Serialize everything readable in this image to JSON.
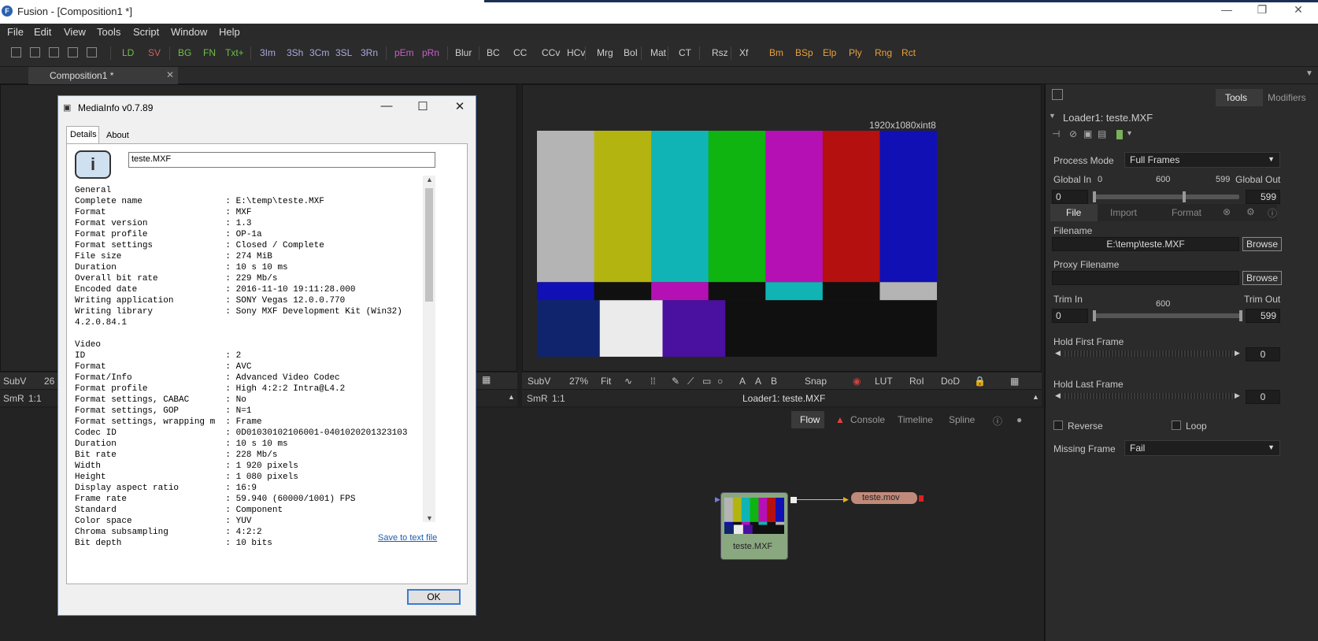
{
  "app": {
    "title": "Fusion - [Composition1 *]",
    "logo": "F"
  },
  "menu": [
    "File",
    "Edit",
    "View",
    "Tools",
    "Script",
    "Window",
    "Help"
  ],
  "toolbar": {
    "items": [
      {
        "label": "LD",
        "color": "#6fbf4a"
      },
      {
        "label": "SV",
        "color": "#d06060"
      },
      {
        "label": "BG",
        "color": "#6fbf4a"
      },
      {
        "label": "FN",
        "color": "#6fbf4a"
      },
      {
        "label": "Txt+",
        "color": "#6fbf4a"
      },
      {
        "label": "3Im",
        "color": "#a9a9e0"
      },
      {
        "label": "3Sh",
        "color": "#a9a9e0"
      },
      {
        "label": "3Cm",
        "color": "#a9a9e0"
      },
      {
        "label": "3SL",
        "color": "#a9a9e0"
      },
      {
        "label": "3Rn",
        "color": "#a9a9e0"
      },
      {
        "label": "pEm",
        "color": "#c55ec5"
      },
      {
        "label": "pRn",
        "color": "#c55ec5"
      },
      {
        "label": "Blur",
        "color": "#cfcfcf"
      },
      {
        "label": "BC",
        "color": "#cfcfcf"
      },
      {
        "label": "CC",
        "color": "#cfcfcf"
      },
      {
        "label": "CCv",
        "color": "#cfcfcf"
      },
      {
        "label": "HCv",
        "color": "#cfcfcf"
      },
      {
        "label": "Mrg",
        "color": "#cfcfcf"
      },
      {
        "label": "BoI",
        "color": "#cfcfcf"
      },
      {
        "label": "Mat",
        "color": "#cfcfcf"
      },
      {
        "label": "CT",
        "color": "#cfcfcf"
      },
      {
        "label": "Rsz",
        "color": "#cfcfcf"
      },
      {
        "label": "Xf",
        "color": "#cfcfcf"
      },
      {
        "label": "Bm",
        "color": "#e8a040"
      },
      {
        "label": "BSp",
        "color": "#e8a040"
      },
      {
        "label": "Elp",
        "color": "#e8a040"
      },
      {
        "label": "Ply",
        "color": "#e8a040"
      },
      {
        "label": "Rng",
        "color": "#e8a040"
      },
      {
        "label": "Rct",
        "color": "#e8a040"
      }
    ]
  },
  "composition_tab": "Composition1 *",
  "left_viewer": {
    "subv": "SubV",
    "zoom": "26",
    "smr": "SmR",
    "ratio": "1:1"
  },
  "viewer": {
    "resolution": "1920x1080xint8",
    "subv": "SubV",
    "zoom": "27%",
    "fit": "Fit",
    "snap": "Snap",
    "lut": "LUT",
    "roi": "RoI",
    "dod": "DoD",
    "smr": "SmR",
    "ratio": "1:1",
    "node_label": "Loader1: teste.MXF"
  },
  "node_tabs": [
    "Flow",
    "Console",
    "Timeline",
    "Spline"
  ],
  "nodes": {
    "loader": "teste.MXF",
    "saver": "teste.mov"
  },
  "inspector": {
    "tabs": [
      "Tools",
      "Modifiers"
    ],
    "tool_name": "Loader1: teste.MXF",
    "process_mode_label": "Process Mode",
    "process_mode": "Full Frames",
    "global_in_label": "Global In",
    "global_out_label": "Global Out",
    "global_min": "0",
    "global_mid": "600",
    "global_max": "599",
    "global_in": "0",
    "global_out": "599",
    "subtabs": [
      "File",
      "Import",
      "Format"
    ],
    "filename_label": "Filename",
    "filename": "E:\\temp\\teste.MXF",
    "browse": "Browse",
    "proxy_label": "Proxy Filename",
    "trim_in_label": "Trim In",
    "trim_out_label": "Trim Out",
    "trim_mid": "600",
    "trim_in": "0",
    "trim_out": "599",
    "hold_first_label": "Hold First Frame",
    "hold_first": "0",
    "hold_last_label": "Hold Last Frame",
    "hold_last": "0",
    "reverse": "Reverse",
    "loop": "Loop",
    "missing_label": "Missing Frame",
    "missing": "Fail"
  },
  "dialog": {
    "title": "MediaInfo v0.7.89",
    "tabs": [
      "Details",
      "About"
    ],
    "file": "teste.MXF",
    "lines": [
      "General",
      "Complete name                : E:\\temp\\teste.MXF",
      "Format                       : MXF",
      "Format version               : 1.3",
      "Format profile               : OP-1a",
      "Format settings              : Closed / Complete",
      "File size                    : 274 MiB",
      "Duration                     : 10 s 10 ms",
      "Overall bit rate             : 229 Mb/s",
      "Encoded date                 : 2016-11-10 19:11:28.000",
      "Writing application          : SONY Vegas 12.0.0.770",
      "Writing library              : Sony MXF Development Kit (Win32)",
      "4.2.0.84.1",
      "",
      "Video",
      "ID                           : 2",
      "Format                       : AVC",
      "Format/Info                  : Advanced Video Codec",
      "Format profile               : High 4:2:2 Intra@L4.2",
      "Format settings, CABAC       : No",
      "Format settings, GOP         : N=1",
      "Format settings, wrapping m  : Frame",
      "Codec ID                     : 0D01030102106001-0401020201323103",
      "Duration                     : 10 s 10 ms",
      "Bit rate                     : 228 Mb/s",
      "Width                        : 1 920 pixels",
      "Height                       : 1 080 pixels",
      "Display aspect ratio         : 16:9",
      "Frame rate                   : 59.940 (60000/1001) FPS",
      "Standard                     : Component",
      "Color space                  : YUV",
      "Chroma subsampling           : 4:2:2",
      "Bit depth                    : 10 bits"
    ],
    "save_link": "Save to text file",
    "ok": "OK"
  },
  "colors": {
    "bar_top": [
      "#b4b4b4",
      "#b4b410",
      "#10b4b4",
      "#10b410",
      "#b410b4",
      "#b41010",
      "#1010b4"
    ]
  }
}
